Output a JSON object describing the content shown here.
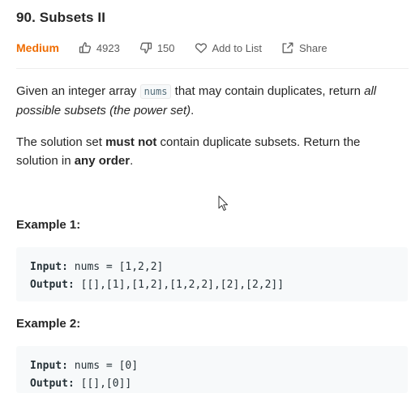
{
  "problem": {
    "title": "90. Subsets II",
    "difficulty": "Medium",
    "likes": "4923",
    "dislikes": "150",
    "add_to_list": "Add to List",
    "share": "Share"
  },
  "description": {
    "p1_before": "Given an integer array ",
    "p1_code": "nums",
    "p1_mid": " that may contain duplicates, return ",
    "p1_italic": "all possible subsets (the power set)",
    "p1_end": ".",
    "p2_before": "The solution set ",
    "p2_bold1": "must not",
    "p2_mid": " contain duplicate subsets. Return the solution in ",
    "p2_bold2": "any order",
    "p2_end": "."
  },
  "examples": [
    {
      "title": "Example 1:",
      "input_label": "Input:",
      "input_value": " nums = [1,2,2]",
      "output_label": "Output:",
      "output_value": " [[],[1],[1,2],[1,2,2],[2],[2,2]]"
    },
    {
      "title": "Example 2:",
      "input_label": "Input:",
      "input_value": " nums = [0]",
      "output_label": "Output:",
      "output_value": " [[],[0]]"
    }
  ],
  "colors": {
    "difficulty_medium": "#ef6c00",
    "code_background": "#f7f9fa",
    "text": "#262626",
    "meta_text": "#5c5c5c"
  },
  "icons": {
    "likes": "thumbs-up-icon",
    "dislikes": "thumbs-down-icon",
    "add_to_list": "heart-icon",
    "share": "share-icon",
    "cursor": "mouse-pointer-icon"
  }
}
